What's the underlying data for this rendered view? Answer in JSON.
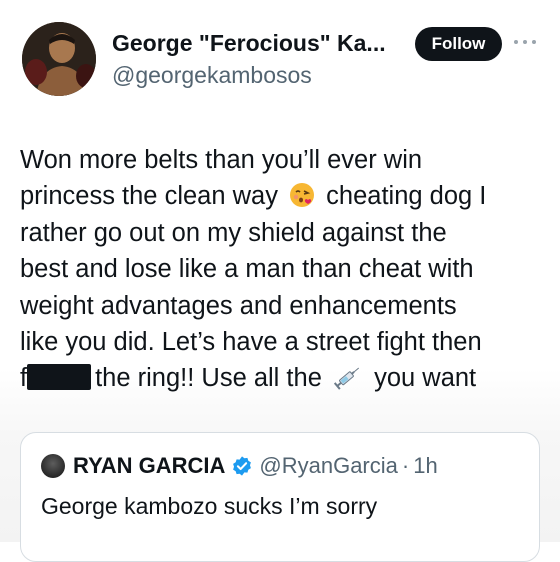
{
  "author": {
    "display_name": "George \"Ferocious\" Ka...",
    "handle": "@georgekambosos"
  },
  "follow_label": "Follow",
  "tweet": {
    "lines": [
      [
        "Won more belts than you’ll ever win"
      ],
      [
        "princess the clean way",
        "cheating dog I"
      ],
      [
        "rather go out on my shield against the"
      ],
      [
        "best and lose like a man than cheat with"
      ],
      [
        "weight advantages and enhancements"
      ],
      [
        "like you did. Let’s have a street fight then"
      ],
      [
        "f",
        "the ring!! Use all the",
        "you want"
      ]
    ]
  },
  "quoted": {
    "name": "RYAN GARCIA",
    "handle": "@RyanGarcia",
    "separator": "·",
    "time": "1h",
    "text": "George kambozo sucks I’m sorry"
  },
  "icons": {
    "more": "more-dots-icon",
    "kiss_emoji": "face-blowing-kiss-icon",
    "syringe": "syringe-icon",
    "verified": "verified-badge-icon"
  },
  "colors": {
    "text": "#0f1419",
    "muted": "#536471",
    "verified": "#1d9bf0",
    "follow_bg": "#0f1419"
  }
}
